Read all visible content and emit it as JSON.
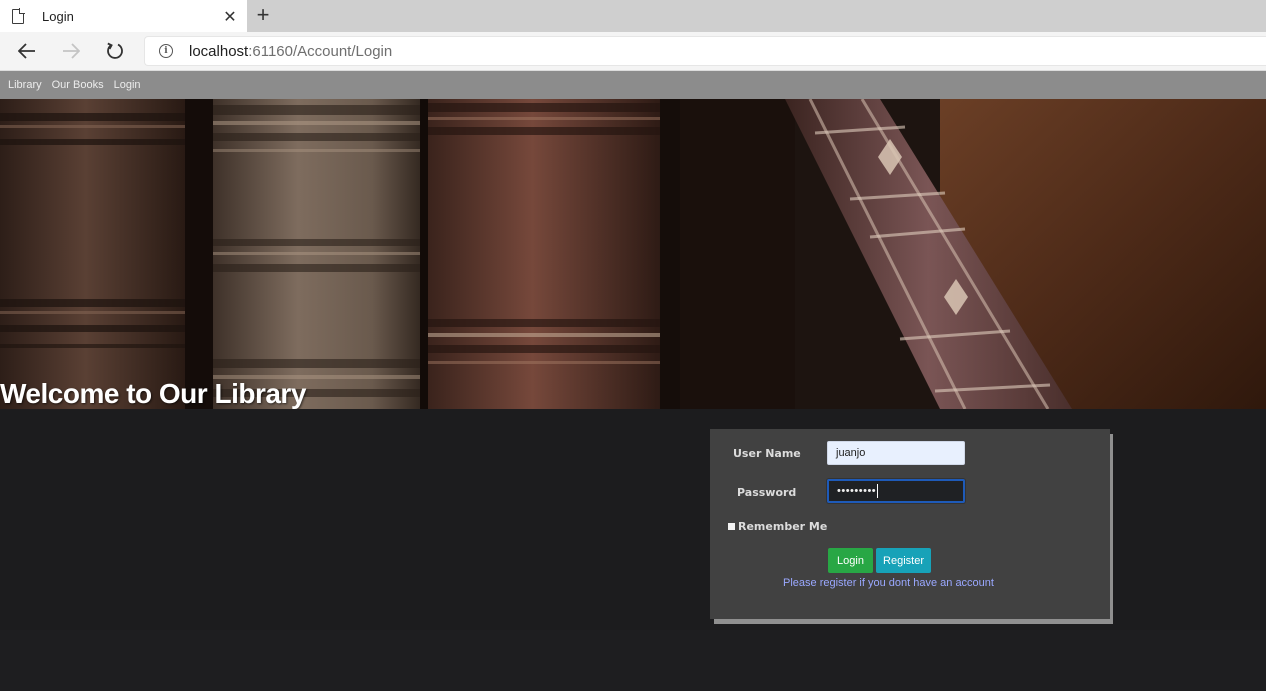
{
  "browser": {
    "tab_title": "Login",
    "tab_close": "✕",
    "new_tab": "+",
    "url_host": "localhost",
    "url_rest": ":61160/Account/Login",
    "info_glyph": "i"
  },
  "site_nav": {
    "items": [
      "Library",
      "Our Books",
      "Login"
    ]
  },
  "hero": {
    "title": "Welcome to Our Library"
  },
  "login_form": {
    "username_label": "User Name",
    "username_value": "juanjo",
    "password_label": "Password",
    "password_masked": "•••••••••",
    "remember_label": "Remember Me",
    "remember_checked": false,
    "login_button": "Login",
    "register_button": "Register",
    "register_hint": "Please register if you dont have an account"
  },
  "colors": {
    "site_nav_bg": "#8c8c8c",
    "page_bg": "#1c1c1e",
    "form_bg": "#414141",
    "login_button": "#28a745",
    "register_button": "#17a2b8",
    "hint_link": "#9aa8ff"
  },
  "icons": {
    "tab": "page-icon",
    "back": "arrow-left-icon",
    "forward": "arrow-right-icon",
    "reload": "reload-icon",
    "site_info": "info-icon"
  }
}
